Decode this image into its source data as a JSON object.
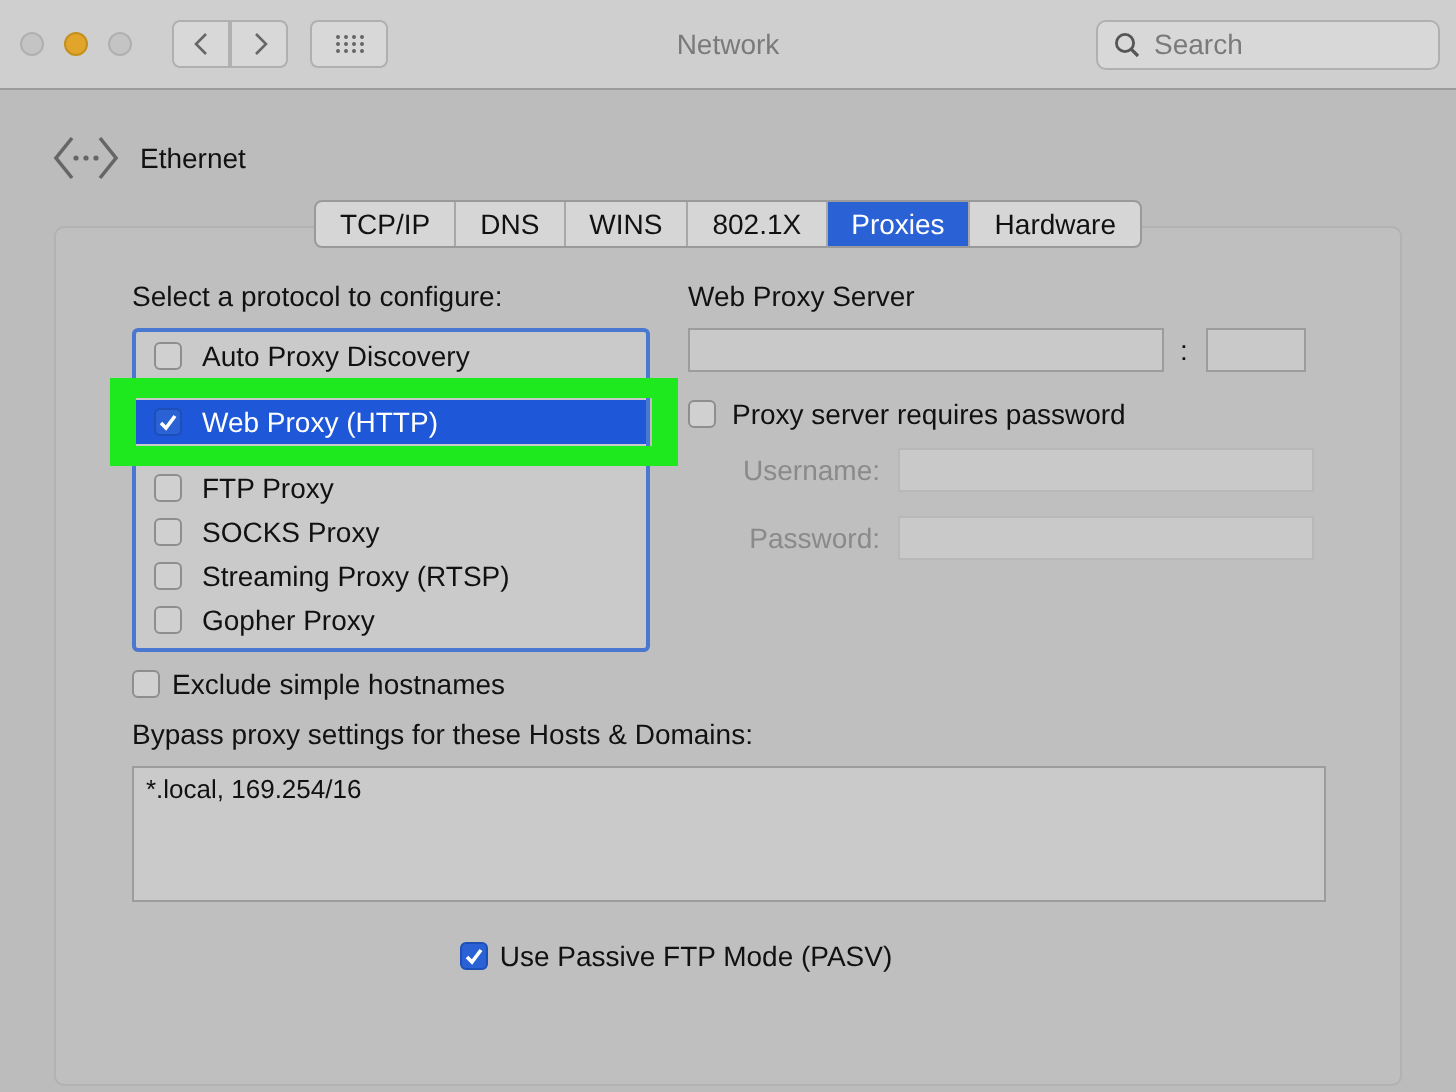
{
  "window": {
    "title": "Network",
    "search": {
      "placeholder": "Search"
    }
  },
  "traffic_lights": [
    {
      "kind": "close",
      "on": false
    },
    {
      "kind": "minimize",
      "on": true
    },
    {
      "kind": "zoom",
      "on": false
    }
  ],
  "interface": {
    "name": "Ethernet"
  },
  "tabs": [
    {
      "label": "TCP/IP",
      "selected": false
    },
    {
      "label": "DNS",
      "selected": false
    },
    {
      "label": "WINS",
      "selected": false
    },
    {
      "label": "802.1X",
      "selected": false
    },
    {
      "label": "Proxies",
      "selected": true
    },
    {
      "label": "Hardware",
      "selected": false
    }
  ],
  "protocols": {
    "title": "Select a protocol to configure:",
    "items": [
      {
        "label": "Auto Proxy Discovery",
        "checked": false,
        "selected": false,
        "highlighted": false
      },
      {
        "label": "Web Proxy (HTTP)",
        "checked": true,
        "selected": true,
        "highlighted": true
      },
      {
        "label": "FTP Proxy",
        "checked": false,
        "selected": false,
        "highlighted": false
      },
      {
        "label": "SOCKS Proxy",
        "checked": false,
        "selected": false,
        "highlighted": false
      },
      {
        "label": "Streaming Proxy (RTSP)",
        "checked": false,
        "selected": false,
        "highlighted": false
      },
      {
        "label": "Gopher Proxy",
        "checked": false,
        "selected": false,
        "highlighted": false
      }
    ]
  },
  "server": {
    "title": "Web Proxy Server",
    "separator": ":",
    "requires_password": {
      "label": "Proxy server requires password",
      "checked": false
    },
    "credentials": [
      {
        "label": "Username:",
        "disabled": true
      },
      {
        "label": "Password:",
        "disabled": true
      }
    ]
  },
  "exclude_simple": {
    "label": "Exclude simple hostnames",
    "checked": false
  },
  "bypass": {
    "label": "Bypass proxy settings for these Hosts & Domains:",
    "value": "*.local, 169.254/16"
  },
  "passive_ftp": {
    "label": "Use Passive FTP Mode (PASV)",
    "checked": true
  }
}
